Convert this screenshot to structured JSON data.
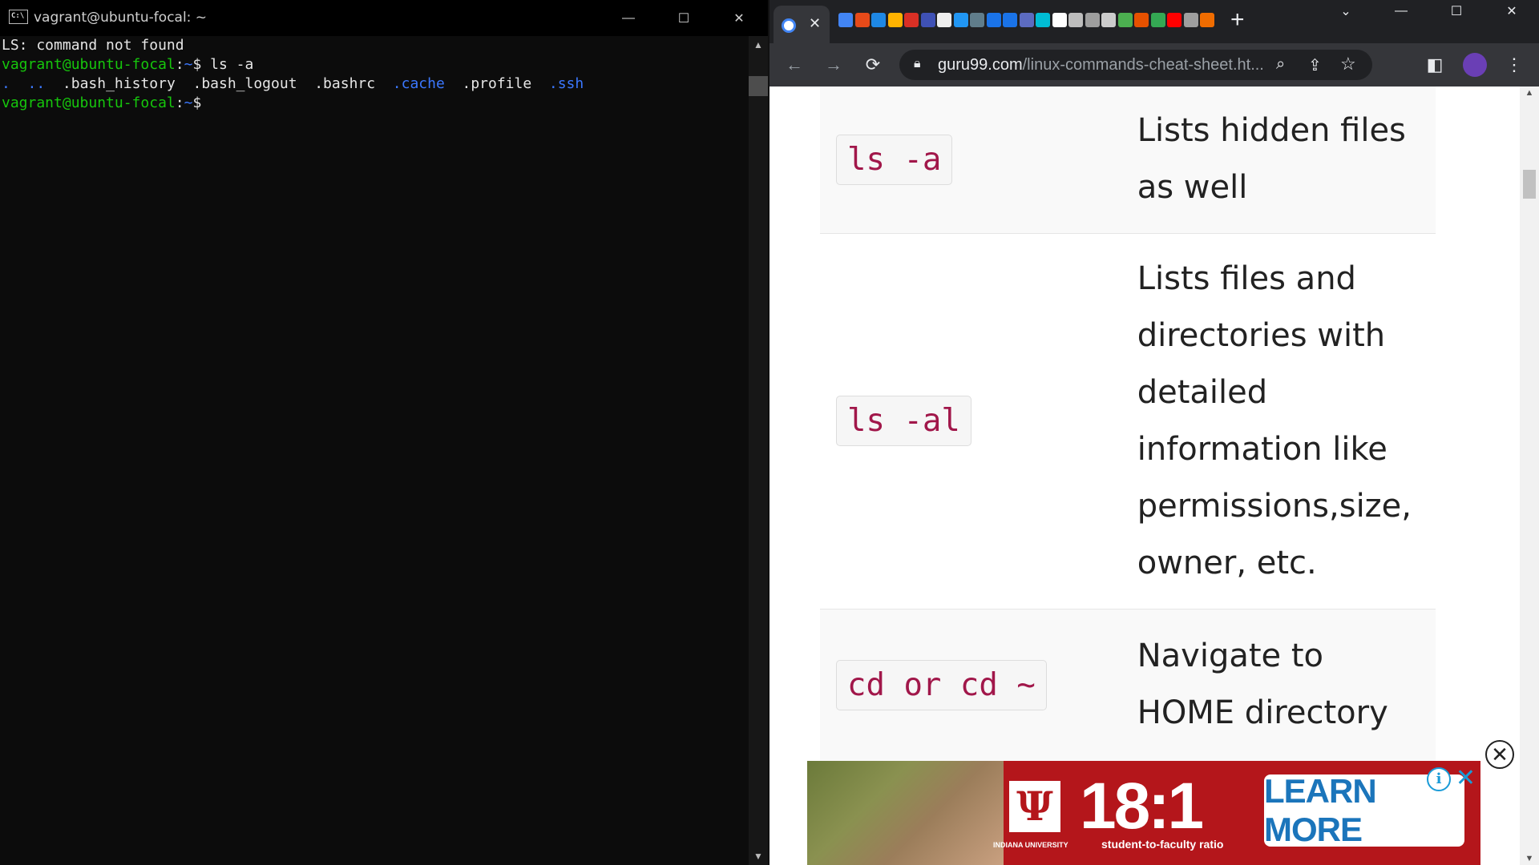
{
  "terminal": {
    "title": "vagrant@ubuntu-focal: ~",
    "icon_label": "C:\\",
    "lines": {
      "l1": "LS: command not found",
      "prompt_user": "vagrant@ubuntu-focal",
      "prompt_path": "~",
      "prompt_sym": "$",
      "cmd": " ls -a",
      "ls_dot": ".",
      "ls_dotdot": "..",
      "ls_bash_history": ".bash_history",
      "ls_bash_logout": ".bash_logout",
      "ls_bashrc": ".bashrc",
      "ls_cache": ".cache",
      "ls_profile": ".profile",
      "ls_ssh": ".ssh"
    },
    "window_buttons": {
      "minimize": "—",
      "maximize": "☐",
      "close": "✕"
    }
  },
  "browser": {
    "active_tab_close": "✕",
    "new_tab": "+",
    "window_buttons": {
      "tabsearch": "⌄",
      "minimize": "—",
      "maximize": "☐",
      "close": "✕"
    },
    "url_host": "guru99.com",
    "url_path": "/linux-commands-cheat-sheet.ht...",
    "favicons": [
      "#4285f4",
      "#e64a19",
      "#1e88e5",
      "#ffb300",
      "#d93025",
      "#3f51b5",
      "#eeeeee",
      "#2196f3",
      "#607d8b",
      "#1a73e8",
      "#1a73e8",
      "#5c6bc0",
      "#00bcd4",
      "#ffffff",
      "#bdbdbd",
      "#9e9e9e",
      "#cccccc",
      "#4caf50",
      "#e65100",
      "#34a853",
      "#ff0000",
      "#9e9e9e",
      "#ef6c00"
    ]
  },
  "page": {
    "rows": [
      {
        "cmd": "ls -a",
        "desc": "Lists hidden files as well"
      },
      {
        "cmd": "ls -al",
        "desc": "Lists files and directories with detailed information like permissions,size, owner, etc."
      },
      {
        "cmd": "cd or cd ~",
        "desc": "Navigate to HOME directory"
      }
    ]
  },
  "ad": {
    "ratio": "18:1",
    "ratio_sub": "student-to-faculty ratio",
    "school": "INDIANA UNIVERSITY",
    "cta": "LEARN MORE",
    "info": "i",
    "close": "✕"
  },
  "ad_close": "✕"
}
